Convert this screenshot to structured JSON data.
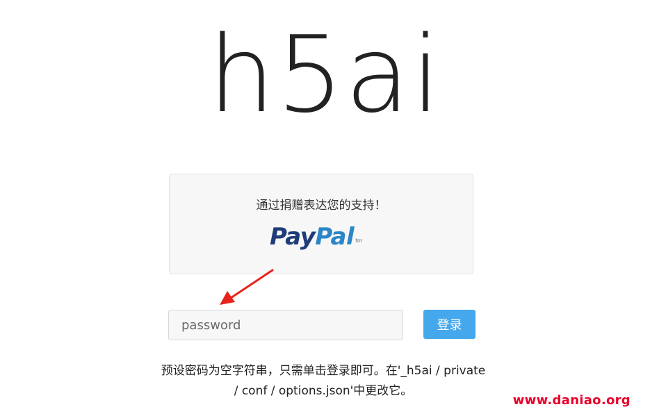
{
  "app": {
    "logo_text": "h5ai"
  },
  "donate": {
    "text": "通过捐赠表达您的支持！",
    "paypal": {
      "part1": "Pay",
      "part2": "Pal",
      "tm": "tm"
    }
  },
  "login": {
    "password_placeholder": "password",
    "button_label": "登录"
  },
  "hint": {
    "text": "预设密码为空字符串，只需单击登录即可。在'_h5ai / private / conf / options.json'中更改它。"
  },
  "watermark": {
    "text": "www.daniao.org"
  },
  "colors": {
    "accent": "#46a8ec",
    "arrow": "#e8231b",
    "paypal_dark": "#1f3c7a",
    "paypal_light": "#2b86c8",
    "watermark": "#e8002b"
  },
  "icons": {
    "annotation": "red-arrow-icon"
  }
}
